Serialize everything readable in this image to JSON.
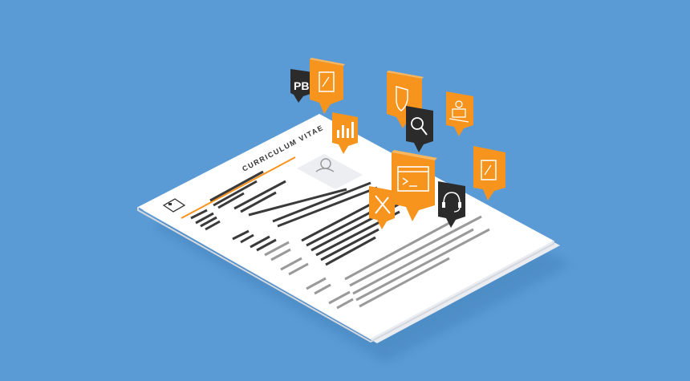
{
  "document": {
    "title": "CURRICULUM VITAE",
    "logo_text": "PB"
  },
  "colors": {
    "background": "#5b9bd5",
    "paper": "#ffffff",
    "paper_shadow": "#e6e9ee",
    "accent_orange": "#f7941d",
    "dark_tile": "#2b2b2b",
    "text_bar": "#3a3a3a",
    "text_bar_light": "#9a9a9a"
  },
  "icons": [
    {
      "name": "pb-logo-icon",
      "style": "dark"
    },
    {
      "name": "tablet-icon",
      "style": "orange"
    },
    {
      "name": "shield-icon",
      "style": "orange"
    },
    {
      "name": "search-icon",
      "style": "dark"
    },
    {
      "name": "person-desk-icon",
      "style": "orange"
    },
    {
      "name": "bar-chart-icon",
      "style": "orange"
    },
    {
      "name": "tablet-icon-2",
      "style": "orange"
    },
    {
      "name": "terminal-window-icon",
      "style": "orange"
    },
    {
      "name": "pencil-ruler-icon",
      "style": "orange"
    },
    {
      "name": "headset-icon",
      "style": "dark"
    }
  ]
}
